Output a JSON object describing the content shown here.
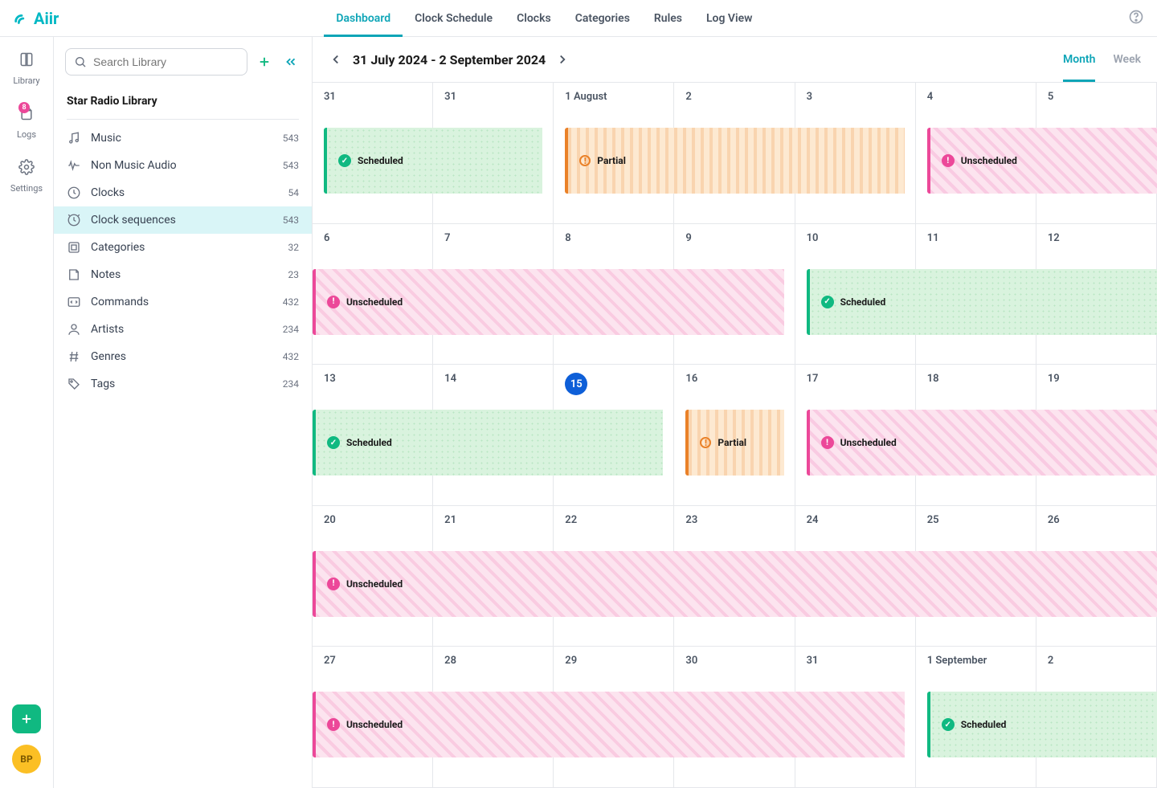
{
  "app": {
    "name": "Aiir",
    "avatar_initials": "BP"
  },
  "topnav": [
    {
      "label": "Dashboard",
      "active": true
    },
    {
      "label": "Clock Schedule"
    },
    {
      "label": "Clocks"
    },
    {
      "label": "Categories"
    },
    {
      "label": "Rules"
    },
    {
      "label": "Log View"
    }
  ],
  "rail": {
    "items": [
      {
        "label": "Library",
        "icon": "book"
      },
      {
        "label": "Logs",
        "icon": "file",
        "badge": "8"
      },
      {
        "label": "Settings",
        "icon": "gear"
      }
    ]
  },
  "sidebar": {
    "search_placeholder": "Search Library",
    "title": "Star Radio Library",
    "items": [
      {
        "label": "Music",
        "icon": "music",
        "count": "543"
      },
      {
        "label": "Non Music Audio",
        "icon": "wave",
        "count": "543"
      },
      {
        "label": "Clocks",
        "icon": "clock",
        "count": "54"
      },
      {
        "label": "Clock sequences",
        "icon": "sequence",
        "count": "543",
        "active": true
      },
      {
        "label": "Categories",
        "icon": "stack",
        "count": "32"
      },
      {
        "label": "Notes",
        "icon": "note",
        "count": "23"
      },
      {
        "label": "Commands",
        "icon": "code",
        "count": "432"
      },
      {
        "label": "Artists",
        "icon": "person",
        "count": "234"
      },
      {
        "label": "Genres",
        "icon": "hash",
        "count": "432"
      },
      {
        "label": "Tags",
        "icon": "tag",
        "count": "234"
      }
    ]
  },
  "calendar_header": {
    "date_range": "31 July 2024 - 2 September 2024",
    "tabs": [
      {
        "label": "Month",
        "active": true
      },
      {
        "label": "Week"
      }
    ]
  },
  "status_labels": {
    "scheduled": "Scheduled",
    "partial": "Partial",
    "unscheduled": "Unscheduled"
  },
  "calendar": {
    "rows": [
      {
        "cells": [
          "31",
          "31",
          "1 August",
          "2",
          "3",
          "4",
          "5"
        ],
        "bands": [
          {
            "type": "scheduled",
            "start": 0,
            "end": 2,
            "label": "Scheduled"
          },
          {
            "type": "partial",
            "start": 2,
            "end": 5,
            "label": "Partial"
          },
          {
            "type": "unscheduled",
            "start": 5,
            "end": 7,
            "label": "Unscheduled",
            "bleed": true
          }
        ]
      },
      {
        "cells": [
          "6",
          "7",
          "8",
          "9",
          "10",
          "11",
          "12"
        ],
        "bands": [
          {
            "type": "unscheduled",
            "start": 0,
            "end": 4,
            "label": "Unscheduled",
            "flushLeft": true
          },
          {
            "type": "scheduled",
            "start": 4,
            "end": 7,
            "label": "Scheduled",
            "bleed": true
          }
        ]
      },
      {
        "cells": [
          "13",
          "14",
          "15",
          "16",
          "17",
          "18",
          "19"
        ],
        "today_index": 2,
        "bands": [
          {
            "type": "scheduled",
            "start": 0,
            "end": 3,
            "label": "Scheduled",
            "flushLeft": true
          },
          {
            "type": "partial",
            "start": 3,
            "end": 4,
            "label": "Partial"
          },
          {
            "type": "unscheduled",
            "start": 4,
            "end": 7,
            "label": "Unscheduled",
            "bleed": true
          }
        ]
      },
      {
        "cells": [
          "20",
          "21",
          "22",
          "23",
          "24",
          "25",
          "26"
        ],
        "bands": [
          {
            "type": "unscheduled",
            "start": 0,
            "end": 7,
            "label": "Unscheduled",
            "flushLeft": true,
            "bleed": true
          }
        ]
      },
      {
        "cells": [
          "27",
          "28",
          "29",
          "30",
          "31",
          "1 September",
          "2"
        ],
        "bands": [
          {
            "type": "unscheduled",
            "start": 0,
            "end": 5,
            "label": "Unscheduled",
            "flushLeft": true
          },
          {
            "type": "scheduled",
            "start": 5,
            "end": 7,
            "label": "Scheduled",
            "bleed": true
          }
        ]
      }
    ]
  }
}
